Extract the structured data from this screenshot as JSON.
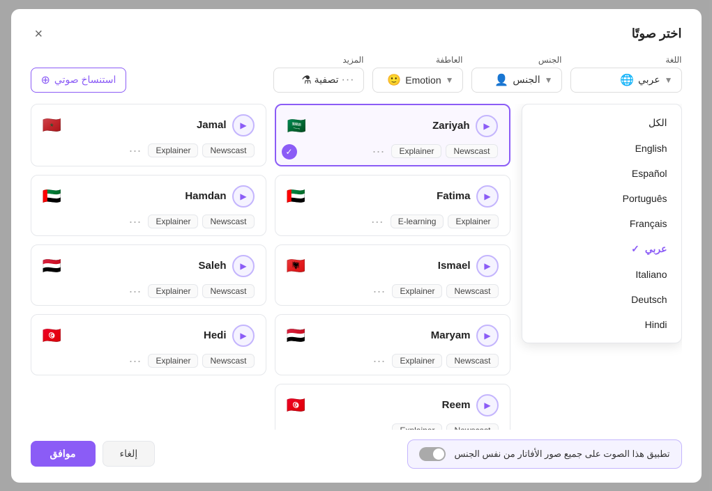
{
  "modal": {
    "title": "اختر صوتًا",
    "close_label": "×"
  },
  "filters": {
    "language_label": "اللغة",
    "language_value": "عربي",
    "gender_label": "الجنس",
    "gender_placeholder": "الجنس",
    "emotion_label": "العاطفة",
    "emotion_value": "Emotion",
    "more_label": "المزيد",
    "more_filter": "تصفية",
    "create_voice_btn": "استنساخ صوتي"
  },
  "dropdown": {
    "items": [
      {
        "id": "all",
        "label": "الكل",
        "selected": false
      },
      {
        "id": "english",
        "label": "English",
        "selected": false
      },
      {
        "id": "espanol",
        "label": "Español",
        "selected": false
      },
      {
        "id": "portugues",
        "label": "Português",
        "selected": false
      },
      {
        "id": "francais",
        "label": "Français",
        "selected": false
      },
      {
        "id": "arabic",
        "label": "عربي",
        "selected": true
      },
      {
        "id": "italiano",
        "label": "Italiano",
        "selected": false
      },
      {
        "id": "deutsch",
        "label": "Deutsch",
        "selected": false
      },
      {
        "id": "hindi",
        "label": "Hindi",
        "selected": false
      }
    ]
  },
  "voices": [
    {
      "id": "zariyah",
      "name": "Zariyah",
      "flag": "🇸🇦",
      "tags": [
        "Newscast",
        "Explainer"
      ],
      "selected": true
    },
    {
      "id": "jamal",
      "name": "Jamal",
      "flag": "🇲🇦",
      "tags": [
        "Newscast",
        "Explainer"
      ],
      "selected": false
    },
    {
      "id": "fatima",
      "name": "Fatima",
      "flag": "🇦🇪",
      "tags": [
        "Explainer",
        "E-learning"
      ],
      "selected": false
    },
    {
      "id": "hamdan",
      "name": "Hamdan",
      "flag": "🇦🇪",
      "tags": [
        "Newscast",
        "Explainer"
      ],
      "selected": false
    },
    {
      "id": "ismael",
      "name": "Ismael",
      "flag": "🇦🇱",
      "tags": [
        "Newscast",
        "Explainer"
      ],
      "selected": false
    },
    {
      "id": "saleh",
      "name": "Saleh",
      "flag": "🇾🇪",
      "tags": [
        "Newscast",
        "Explainer"
      ],
      "selected": false
    },
    {
      "id": "maryam",
      "name": "Maryam",
      "flag": "🇾🇪",
      "tags": [
        "Newscast",
        "Explainer"
      ],
      "selected": false
    },
    {
      "id": "hedi",
      "name": "Hedi",
      "flag": "🇹🇳",
      "tags": [
        "Newscast",
        "Explainer"
      ],
      "selected": false
    },
    {
      "id": "reem",
      "name": "Reem",
      "flag": "🇹🇳",
      "tags": [
        "Newscast",
        "Explainer"
      ],
      "selected": false
    }
  ],
  "footer": {
    "apply_text": "تطبيق هذا الصوت على جميع صور الأفاتار من نفس الجنس",
    "cancel_btn": "إلغاء",
    "confirm_btn": "موافق"
  }
}
